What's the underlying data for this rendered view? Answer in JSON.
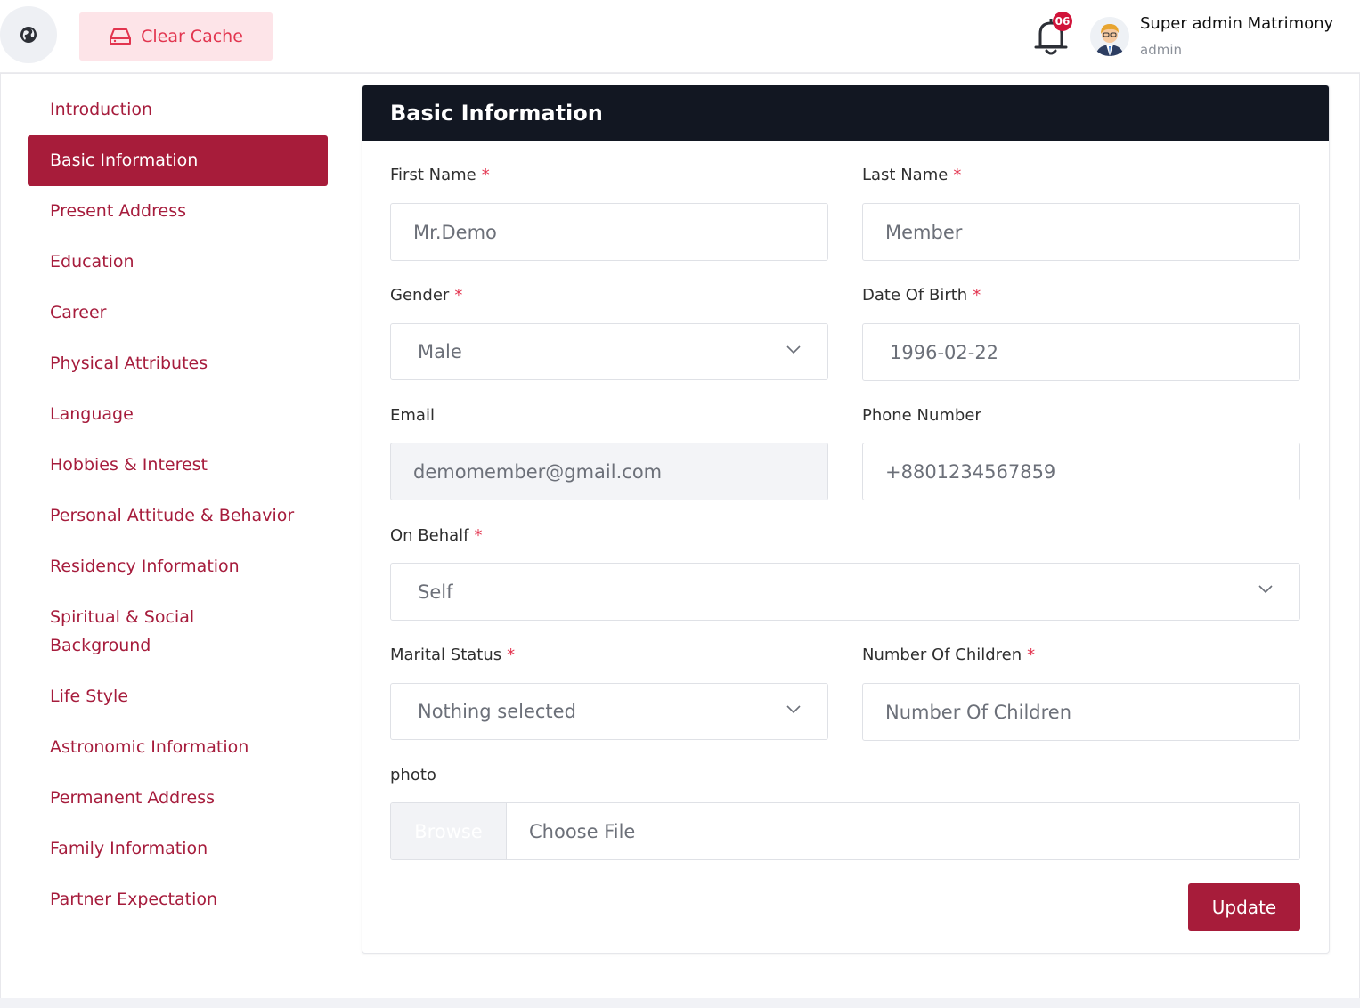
{
  "header": {
    "clear_cache_label": "Clear Cache",
    "notification_count": "06",
    "user_name": "Super admin Matrimony",
    "user_role": "admin"
  },
  "sidebar": {
    "items": [
      {
        "label": "Introduction"
      },
      {
        "label": "Basic Information",
        "active": true
      },
      {
        "label": "Present Address"
      },
      {
        "label": "Education"
      },
      {
        "label": "Career"
      },
      {
        "label": "Physical Attributes"
      },
      {
        "label": "Language"
      },
      {
        "label": "Hobbies & Interest"
      },
      {
        "label": "Personal Attitude & Behavior"
      },
      {
        "label": "Residency Information"
      },
      {
        "label": "Spiritual & Social Background"
      },
      {
        "label": "Life Style"
      },
      {
        "label": "Astronomic Information"
      },
      {
        "label": "Permanent Address"
      },
      {
        "label": "Family Information"
      },
      {
        "label": "Partner Expectation"
      }
    ]
  },
  "form": {
    "title": "Basic Information",
    "required_mark": "*",
    "first_name": {
      "label": "First Name",
      "value": "Mr.Demo"
    },
    "last_name": {
      "label": "Last Name",
      "value": "Member"
    },
    "gender": {
      "label": "Gender",
      "value": "Male"
    },
    "dob": {
      "label": "Date Of Birth",
      "value": "1996-02-22"
    },
    "email": {
      "label": "Email",
      "value": "demomember@gmail.com"
    },
    "phone": {
      "label": "Phone Number",
      "value": "+8801234567859"
    },
    "on_behalf": {
      "label": "On Behalf",
      "value": "Self"
    },
    "marital_status": {
      "label": "Marital Status",
      "value": "Nothing selected"
    },
    "children": {
      "label": "Number Of Children",
      "placeholder": "Number Of Children"
    },
    "photo": {
      "label": "photo",
      "browse_label": "Browse",
      "file_text": "Choose File"
    },
    "update_label": "Update"
  },
  "colors": {
    "accent": "#a71c3a",
    "header_dark": "#121722",
    "required": "#e3344f"
  }
}
